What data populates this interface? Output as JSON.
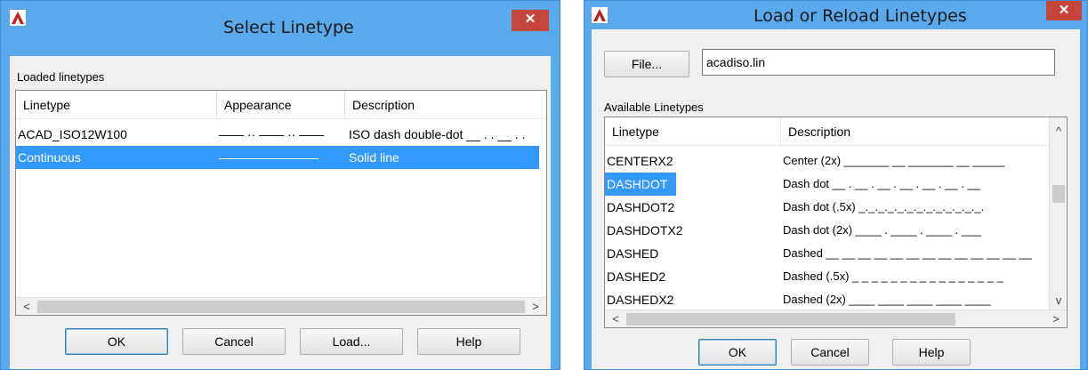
{
  "left_dialog": {
    "title": "Select Linetype",
    "close_glyph": "✕",
    "group_label": "Loaded linetypes",
    "columns": [
      "Linetype",
      "Appearance",
      "Description"
    ],
    "rows": [
      {
        "linetype": "ACAD_ISO12W100",
        "appearance": "—— ·· —— ·· ——",
        "description": "ISO dash double-dot __ . . __ . .",
        "selected": false
      },
      {
        "linetype": "Continuous",
        "appearance": "————————",
        "description": "Solid line",
        "selected": true
      }
    ],
    "scroll_left": "<",
    "scroll_right": ">",
    "buttons": {
      "ok": "OK",
      "cancel": "Cancel",
      "load": "Load...",
      "help": "Help"
    }
  },
  "right_dialog": {
    "title": "Load or Reload Linetypes",
    "close_glyph": "✕",
    "file_button": "File...",
    "file_value": "acadiso.lin",
    "group_label": "Available Linetypes",
    "columns": [
      "Linetype",
      "Description"
    ],
    "rows": [
      {
        "linetype": "CENTERX2",
        "description": "Center (2x) _______ __ _______ __ _____",
        "selected": false
      },
      {
        "linetype": "DASHDOT",
        "description": "Dash dot __ . __ . __ . __ . __ . __ . __",
        "selected": true
      },
      {
        "linetype": "DASHDOT2",
        "description": "Dash dot (.5x) _._._._._._._._._._._._._.",
        "selected": false
      },
      {
        "linetype": "DASHDOTX2",
        "description": "Dash dot (2x) ____ . ____ . ____ . ___",
        "selected": false
      },
      {
        "linetype": "DASHED",
        "description": "Dashed __ __ __ __ __ __ __ __ __ __ __ __ __",
        "selected": false
      },
      {
        "linetype": "DASHED2",
        "description": "Dashed (.5x) _ _ _ _ _ _ _ _ _ _ _ _ _ _ _ _",
        "selected": false
      },
      {
        "linetype": "DASHEDX2",
        "description": "Dashed (2x) ____ ____ ____ ____ ____",
        "selected": false
      }
    ],
    "scroll_up": "^",
    "scroll_down": "v",
    "scroll_left": "<",
    "scroll_right": ">",
    "buttons": {
      "ok": "OK",
      "cancel": "Cancel",
      "help": "Help"
    }
  },
  "colors": {
    "titlebar": "#5aa9ec",
    "close_button": "#c7463c",
    "selection": "#3399ff",
    "app_icon": "#c0201a"
  },
  "icons": [
    "autocad-logo-icon",
    "close-icon"
  ]
}
